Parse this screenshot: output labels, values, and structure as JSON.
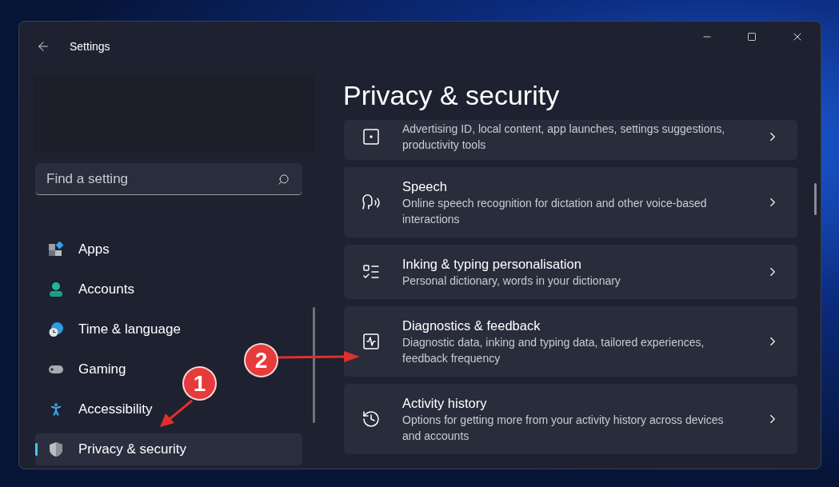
{
  "window": {
    "title": "Settings"
  },
  "search": {
    "placeholder": "Find a setting"
  },
  "sidebar": {
    "items": [
      {
        "label": "Apps",
        "selected": false
      },
      {
        "label": "Accounts",
        "selected": false
      },
      {
        "label": "Time & language",
        "selected": false
      },
      {
        "label": "Gaming",
        "selected": false
      },
      {
        "label": "Accessibility",
        "selected": false
      },
      {
        "label": "Privacy & security",
        "selected": true
      }
    ]
  },
  "page": {
    "title": "Privacy & security",
    "cards": [
      {
        "description": "Advertising ID, local content, app launches, settings suggestions, productivity tools"
      },
      {
        "title": "Speech",
        "description": "Online speech recognition for dictation and other voice-based interactions"
      },
      {
        "title": "Inking & typing personalisation",
        "description": "Personal dictionary, words in your dictionary"
      },
      {
        "title": "Diagnostics & feedback",
        "description": "Diagnostic data, inking and typing data, tailored experiences, feedback frequency"
      },
      {
        "title": "Activity history",
        "description": "Options for getting more from your activity history across devices and accounts"
      }
    ]
  },
  "annotations": [
    {
      "label": "1"
    },
    {
      "label": "2"
    }
  ]
}
